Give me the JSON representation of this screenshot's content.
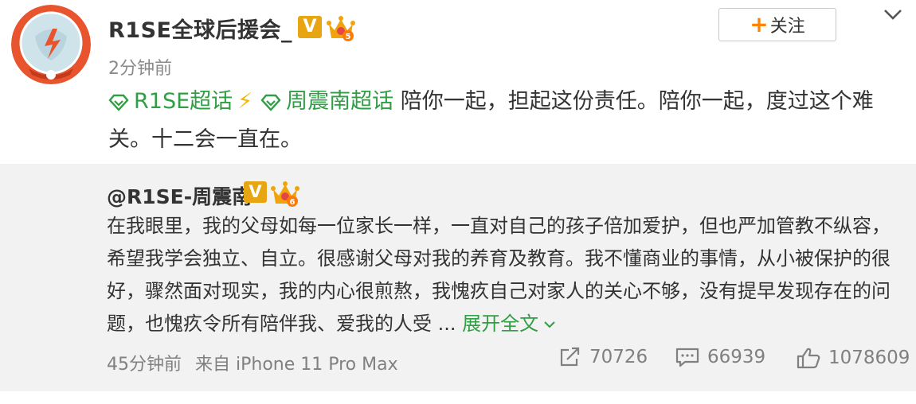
{
  "post": {
    "author": "R1SE全球后援会_",
    "author_verified_badge": "V",
    "author_level": "5",
    "time": "2分钟前",
    "follow_label": "关注",
    "follow_plus": "+",
    "content": {
      "topic1": "R1SE超话",
      "bolt": "⚡",
      "topic2": "周震南超话",
      "text": "陪你一起，担起这份责任。陪你一起，度过这个难关。十二会一直在。"
    }
  },
  "repost": {
    "author": "@R1SE-周震南",
    "author_verified_badge": "V",
    "author_level": "6",
    "text": "在我眼里，我的父母如每一位家长一样，一直对自己的孩子倍加爱护，但也严加管教不纵容，希望我学会独立、自立。很感谢父母对我的养育及教育。我不懂商业的事情，从小被保护的很好，骤然面对现实，我的内心很煎熬，我愧疚自己对家人的关心不够，没有提早发现存在的问题，也愧疚令所有陪伴我、爱我的人受 ...",
    "expand_label": "展开全文",
    "time": "45分钟前",
    "source": "来自 iPhone 11 Pro Max",
    "reposts": "70726",
    "comments": "66939",
    "likes": "1078609"
  },
  "colors": {
    "topic_green": "#2f9e44",
    "follow_accent": "#ff8200",
    "verified_gold": "#e8a512",
    "repost_bg": "#f2f2f2"
  },
  "icons": [
    "avatar",
    "verified-v-icon",
    "level-crown-icon",
    "chevron-down-icon",
    "super-topic-icon",
    "lightning-icon",
    "expand-chevron-icon",
    "repost-icon",
    "comment-icon",
    "like-icon"
  ]
}
